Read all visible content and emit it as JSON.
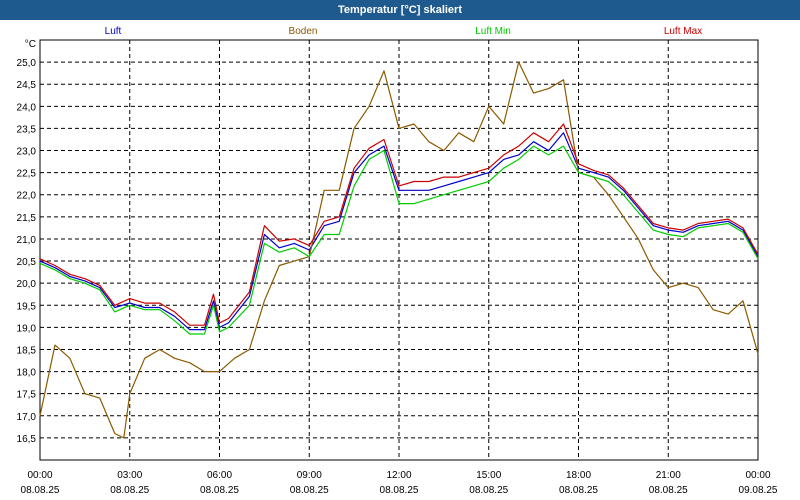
{
  "window": {
    "title": "Temperatur [°C] skaliert"
  },
  "chart_data": {
    "type": "line",
    "title": "Temperatur [°C] skaliert",
    "ylabel": "°C",
    "ylim": [
      16.0,
      25.5
    ],
    "yticks": [
      "16,5",
      "17,0",
      "17,5",
      "18,0",
      "18,5",
      "19,0",
      "19,5",
      "20,0",
      "20,5",
      "21,0",
      "21,5",
      "22,0",
      "22,5",
      "23,0",
      "23,5",
      "24,0",
      "24,5",
      "25,0"
    ],
    "xlim": [
      0,
      24
    ],
    "xticks": [
      {
        "time": "00:00",
        "date": "08.08.25"
      },
      {
        "time": "03:00",
        "date": "08.08.25"
      },
      {
        "time": "06:00",
        "date": "08.08.25"
      },
      {
        "time": "09:00",
        "date": "08.08.25"
      },
      {
        "time": "12:00",
        "date": "08.08.25"
      },
      {
        "time": "15:00",
        "date": "08.08.25"
      },
      {
        "time": "18:00",
        "date": "08.08.25"
      },
      {
        "time": "21:00",
        "date": "08.08.25"
      },
      {
        "time": "00:00",
        "date": "09.08.25"
      }
    ],
    "grid": true,
    "legend_position": "top",
    "series": [
      {
        "name": "Luft",
        "color": "#0000cc",
        "points": [
          [
            0,
            20.5
          ],
          [
            0.5,
            20.35
          ],
          [
            1,
            20.15
          ],
          [
            1.5,
            20.05
          ],
          [
            2,
            19.9
          ],
          [
            2.5,
            19.45
          ],
          [
            3,
            19.55
          ],
          [
            3.5,
            19.45
          ],
          [
            4,
            19.45
          ],
          [
            4.5,
            19.25
          ],
          [
            5,
            18.95
          ],
          [
            5.5,
            18.95
          ],
          [
            5.8,
            19.6
          ],
          [
            6,
            19.0
          ],
          [
            6.3,
            19.1
          ],
          [
            7,
            19.7
          ],
          [
            7.5,
            21.1
          ],
          [
            8,
            20.8
          ],
          [
            8.5,
            20.9
          ],
          [
            9,
            20.75
          ],
          [
            9.5,
            21.3
          ],
          [
            10,
            21.4
          ],
          [
            10.5,
            22.5
          ],
          [
            11,
            22.9
          ],
          [
            11.5,
            23.1
          ],
          [
            12,
            22.1
          ],
          [
            12.5,
            22.1
          ],
          [
            13,
            22.1
          ],
          [
            13.5,
            22.2
          ],
          [
            14,
            22.3
          ],
          [
            14.5,
            22.4
          ],
          [
            15,
            22.5
          ],
          [
            15.5,
            22.8
          ],
          [
            16,
            22.9
          ],
          [
            16.5,
            23.2
          ],
          [
            17,
            23.0
          ],
          [
            17.5,
            23.4
          ],
          [
            18,
            22.6
          ],
          [
            18.5,
            22.5
          ],
          [
            19,
            22.4
          ],
          [
            19.5,
            22.1
          ],
          [
            20,
            21.7
          ],
          [
            20.5,
            21.3
          ],
          [
            21,
            21.2
          ],
          [
            21.5,
            21.15
          ],
          [
            22,
            21.3
          ],
          [
            22.5,
            21.35
          ],
          [
            23,
            21.4
          ],
          [
            23.5,
            21.2
          ],
          [
            24,
            20.6
          ]
        ]
      },
      {
        "name": "Boden",
        "color": "#8b5a00",
        "points": [
          [
            0,
            17.0
          ],
          [
            0.5,
            18.6
          ],
          [
            1,
            18.3
          ],
          [
            1.5,
            17.5
          ],
          [
            2,
            17.4
          ],
          [
            2.5,
            16.6
          ],
          [
            2.8,
            16.5
          ],
          [
            3,
            17.5
          ],
          [
            3.5,
            18.3
          ],
          [
            4,
            18.5
          ],
          [
            4.5,
            18.3
          ],
          [
            5,
            18.2
          ],
          [
            5.5,
            18.0
          ],
          [
            6,
            18.0
          ],
          [
            6.5,
            18.3
          ],
          [
            7,
            18.5
          ],
          [
            7.5,
            19.6
          ],
          [
            8,
            20.4
          ],
          [
            8.5,
            20.5
          ],
          [
            9,
            20.6
          ],
          [
            9.5,
            22.1
          ],
          [
            10,
            22.1
          ],
          [
            10.5,
            23.5
          ],
          [
            11,
            24.0
          ],
          [
            11.5,
            24.8
          ],
          [
            12,
            23.5
          ],
          [
            12.5,
            23.6
          ],
          [
            13,
            23.2
          ],
          [
            13.5,
            23.0
          ],
          [
            14,
            23.4
          ],
          [
            14.5,
            23.2
          ],
          [
            15,
            24.0
          ],
          [
            15.5,
            23.6
          ],
          [
            16,
            25.0
          ],
          [
            16.5,
            24.3
          ],
          [
            17,
            24.4
          ],
          [
            17.5,
            24.6
          ],
          [
            18,
            22.5
          ],
          [
            18.5,
            22.4
          ],
          [
            19,
            22.0
          ],
          [
            19.5,
            21.5
          ],
          [
            20,
            21.0
          ],
          [
            20.5,
            20.3
          ],
          [
            21,
            19.9
          ],
          [
            21.5,
            20.0
          ],
          [
            22,
            19.9
          ],
          [
            22.5,
            19.4
          ],
          [
            23,
            19.3
          ],
          [
            23.5,
            19.6
          ],
          [
            24,
            18.4
          ]
        ]
      },
      {
        "name": "Luft Min",
        "color": "#00cc00",
        "points": [
          [
            0,
            20.45
          ],
          [
            0.5,
            20.3
          ],
          [
            1,
            20.1
          ],
          [
            1.5,
            20.0
          ],
          [
            2,
            19.85
          ],
          [
            2.5,
            19.35
          ],
          [
            3,
            19.5
          ],
          [
            3.5,
            19.4
          ],
          [
            4,
            19.4
          ],
          [
            4.5,
            19.15
          ],
          [
            5,
            18.85
          ],
          [
            5.5,
            18.85
          ],
          [
            5.8,
            19.5
          ],
          [
            6,
            18.9
          ],
          [
            6.3,
            19.0
          ],
          [
            7,
            19.5
          ],
          [
            7.5,
            20.9
          ],
          [
            8,
            20.7
          ],
          [
            8.5,
            20.8
          ],
          [
            9,
            20.6
          ],
          [
            9.5,
            21.1
          ],
          [
            10,
            21.1
          ],
          [
            10.5,
            22.2
          ],
          [
            11,
            22.8
          ],
          [
            11.5,
            23.0
          ],
          [
            12,
            21.8
          ],
          [
            12.5,
            21.8
          ],
          [
            13,
            21.9
          ],
          [
            13.5,
            22.0
          ],
          [
            14,
            22.1
          ],
          [
            14.5,
            22.2
          ],
          [
            15,
            22.3
          ],
          [
            15.5,
            22.6
          ],
          [
            16,
            22.8
          ],
          [
            16.5,
            23.1
          ],
          [
            17,
            22.9
          ],
          [
            17.5,
            23.1
          ],
          [
            18,
            22.5
          ],
          [
            18.5,
            22.4
          ],
          [
            19,
            22.3
          ],
          [
            19.5,
            22.0
          ],
          [
            20,
            21.6
          ],
          [
            20.5,
            21.2
          ],
          [
            21,
            21.1
          ],
          [
            21.5,
            21.05
          ],
          [
            22,
            21.25
          ],
          [
            22.5,
            21.3
          ],
          [
            23,
            21.35
          ],
          [
            23.5,
            21.15
          ],
          [
            24,
            20.55
          ]
        ]
      },
      {
        "name": "Luft Max",
        "color": "#cc0000",
        "points": [
          [
            0,
            20.55
          ],
          [
            0.5,
            20.4
          ],
          [
            1,
            20.2
          ],
          [
            1.5,
            20.1
          ],
          [
            2,
            19.95
          ],
          [
            2.5,
            19.5
          ],
          [
            3,
            19.65
          ],
          [
            3.5,
            19.55
          ],
          [
            4,
            19.55
          ],
          [
            4.5,
            19.35
          ],
          [
            5,
            19.05
          ],
          [
            5.5,
            19.05
          ],
          [
            5.8,
            19.75
          ],
          [
            6,
            19.1
          ],
          [
            6.3,
            19.2
          ],
          [
            7,
            19.8
          ],
          [
            7.5,
            21.3
          ],
          [
            8,
            20.95
          ],
          [
            8.5,
            21.0
          ],
          [
            9,
            20.85
          ],
          [
            9.5,
            21.4
          ],
          [
            10,
            21.5
          ],
          [
            10.5,
            22.6
          ],
          [
            11,
            23.05
          ],
          [
            11.5,
            23.25
          ],
          [
            12,
            22.2
          ],
          [
            12.5,
            22.3
          ],
          [
            13,
            22.3
          ],
          [
            13.5,
            22.4
          ],
          [
            14,
            22.4
          ],
          [
            14.5,
            22.5
          ],
          [
            15,
            22.6
          ],
          [
            15.5,
            22.9
          ],
          [
            16,
            23.1
          ],
          [
            16.5,
            23.4
          ],
          [
            17,
            23.2
          ],
          [
            17.5,
            23.6
          ],
          [
            18,
            22.7
          ],
          [
            18.5,
            22.55
          ],
          [
            19,
            22.45
          ],
          [
            19.5,
            22.15
          ],
          [
            20,
            21.75
          ],
          [
            20.5,
            21.35
          ],
          [
            21,
            21.25
          ],
          [
            21.5,
            21.2
          ],
          [
            22,
            21.35
          ],
          [
            22.5,
            21.4
          ],
          [
            23,
            21.45
          ],
          [
            23.5,
            21.25
          ],
          [
            24,
            20.65
          ]
        ]
      }
    ]
  }
}
